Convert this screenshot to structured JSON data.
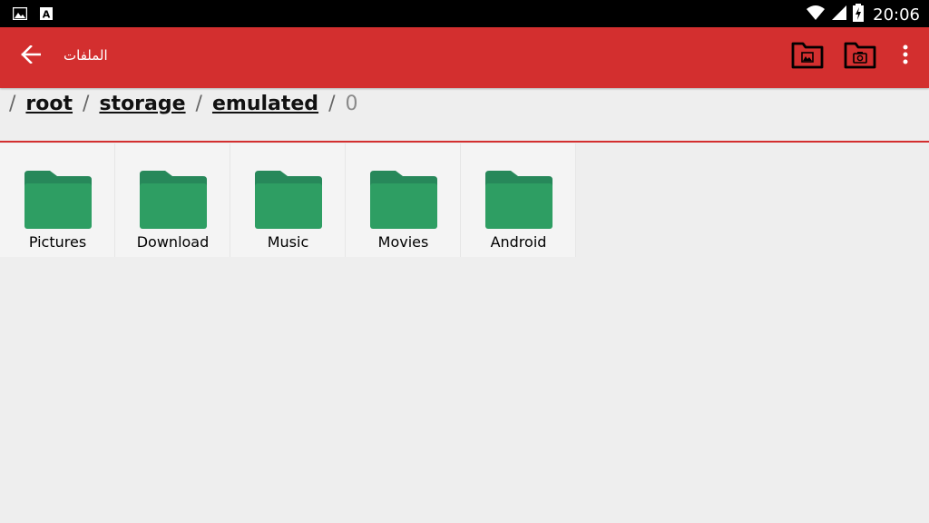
{
  "status_bar": {
    "time": "20:06",
    "left_icons": [
      "image-icon",
      "font-a-icon"
    ],
    "right_icons": [
      "wifi-icon",
      "cellular-signal-icon",
      "battery-charging-icon"
    ]
  },
  "toolbar": {
    "title": "الملفات",
    "actions": [
      "back-arrow-icon",
      "folder-gallery-icon",
      "folder-camera-icon",
      "more-vertical-icon"
    ]
  },
  "breadcrumb": {
    "items": [
      "root",
      "storage",
      "emulated"
    ],
    "current": "0",
    "separator": "/"
  },
  "folders": [
    {
      "label": "Pictures"
    },
    {
      "label": "Download"
    },
    {
      "label": "Music"
    },
    {
      "label": "Movies"
    },
    {
      "label": "Android"
    }
  ],
  "colors": {
    "toolbar": "#d32f2f",
    "folder": "#2e9e63",
    "folder_tab": "#27885a",
    "background": "#eeeeee"
  }
}
